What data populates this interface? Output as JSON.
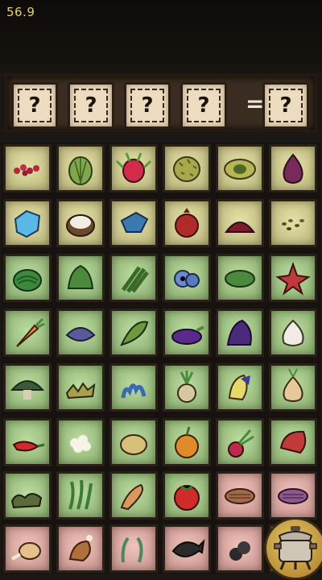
{
  "timer": "56.9",
  "recipe": {
    "slots": [
      "?",
      "?",
      "?",
      "?"
    ],
    "equals": "=",
    "result": "?"
  },
  "grid": {
    "rows": [
      [
        {
          "name": "berries",
          "tint": "yellow"
        },
        {
          "name": "cactus-flesh",
          "tint": "yellow"
        },
        {
          "name": "dragon-fruit",
          "tint": "yellow"
        },
        {
          "name": "durian",
          "tint": "yellow"
        },
        {
          "name": "extra-durian",
          "tint": "yellow"
        },
        {
          "name": "red-onion",
          "tint": "yellow"
        }
      ],
      [
        {
          "name": "ice",
          "tint": "yellow"
        },
        {
          "name": "coconut",
          "tint": "yellow"
        },
        {
          "name": "blue-cap",
          "tint": "yellow"
        },
        {
          "name": "pomegranate",
          "tint": "yellow"
        },
        {
          "name": "jam",
          "tint": "yellow"
        },
        {
          "name": "seeds",
          "tint": "yellow"
        }
      ],
      [
        {
          "name": "watermelon",
          "tint": "green"
        },
        {
          "name": "kale",
          "tint": "green"
        },
        {
          "name": "asparagus",
          "tint": "green"
        },
        {
          "name": "eye-plant",
          "tint": "green"
        },
        {
          "name": "cucumber",
          "tint": "green"
        },
        {
          "name": "red-flower",
          "tint": "green"
        }
      ],
      [
        {
          "name": "carrot",
          "tint": "green"
        },
        {
          "name": "blue-cap-slice",
          "tint": "green"
        },
        {
          "name": "corn",
          "tint": "green"
        },
        {
          "name": "eggplant",
          "tint": "green"
        },
        {
          "name": "blue-kale",
          "tint": "green"
        },
        {
          "name": "garlic",
          "tint": "green"
        }
      ],
      [
        {
          "name": "mushroom",
          "tint": "green"
        },
        {
          "name": "lichen",
          "tint": "green"
        },
        {
          "name": "blue-coral",
          "tint": "green"
        },
        {
          "name": "mandrake",
          "tint": "green"
        },
        {
          "name": "blue-flower",
          "tint": "green"
        },
        {
          "name": "onion",
          "tint": "green"
        }
      ],
      [
        {
          "name": "pepper",
          "tint": "green"
        },
        {
          "name": "popcorn",
          "tint": "green"
        },
        {
          "name": "potato",
          "tint": "green"
        },
        {
          "name": "pumpkin",
          "tint": "green"
        },
        {
          "name": "radish",
          "tint": "green"
        },
        {
          "name": "red-mushroom",
          "tint": "green"
        }
      ],
      [
        {
          "name": "seaweed-pile",
          "tint": "green"
        },
        {
          "name": "seaweed",
          "tint": "green"
        },
        {
          "name": "sweet-potato",
          "tint": "green"
        },
        {
          "name": "tomato",
          "tint": "green"
        },
        {
          "name": "cooked-meat",
          "tint": "pink"
        },
        {
          "name": "steak",
          "tint": "pink"
        }
      ],
      [
        {
          "name": "drumstick",
          "tint": "pink"
        },
        {
          "name": "ham",
          "tint": "pink"
        },
        {
          "name": "frog-legs",
          "tint": "pink"
        },
        {
          "name": "fish",
          "tint": "pink"
        },
        {
          "name": "meat-chunks",
          "tint": "pink"
        },
        {
          "name": "crockpot",
          "tint": "pink"
        }
      ]
    ]
  },
  "icons": {
    "cook": "crockpot-icon"
  }
}
